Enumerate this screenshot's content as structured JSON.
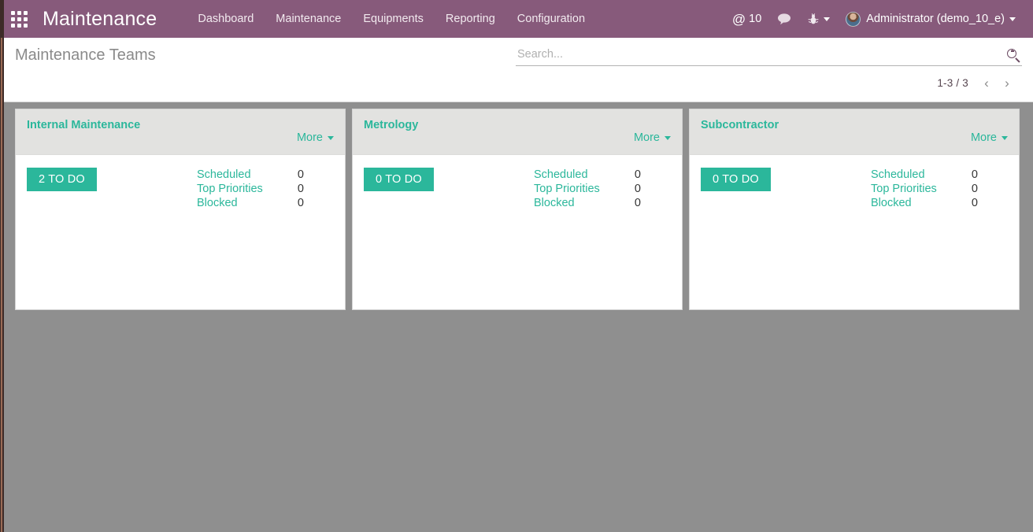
{
  "navbar": {
    "apps_icon": "apps-grid-icon",
    "brand": "Maintenance",
    "menu": [
      {
        "label": "Dashboard"
      },
      {
        "label": "Maintenance"
      },
      {
        "label": "Equipments"
      },
      {
        "label": "Reporting"
      },
      {
        "label": "Configuration"
      }
    ],
    "systray": {
      "mentions_glyph": "@",
      "mentions_count": "10",
      "messages_icon": "chat-bubble-icon",
      "debug_icon": "bug-icon",
      "user_name": "Administrator (demo_10_e)",
      "avatar_icon": "user-avatar"
    },
    "background_color": "#875a7b"
  },
  "control_panel": {
    "title": "Maintenance Teams",
    "search": {
      "value": "",
      "placeholder": "Search...",
      "icon": "magnifier-icon"
    },
    "pager": {
      "count": "1-3 / 3",
      "previous_glyph": "‹",
      "next_glyph": "›"
    }
  },
  "board": {
    "more_label": "More",
    "cards": [
      {
        "title": "Internal Maintenance",
        "todo_label": "2 TO DO",
        "stats": [
          {
            "label": "Scheduled",
            "value": "0"
          },
          {
            "label": "Top Priorities",
            "value": "0"
          },
          {
            "label": "Blocked",
            "value": "0"
          }
        ]
      },
      {
        "title": "Metrology",
        "todo_label": "0 TO DO",
        "stats": [
          {
            "label": "Scheduled",
            "value": "0"
          },
          {
            "label": "Top Priorities",
            "value": "0"
          },
          {
            "label": "Blocked",
            "value": "0"
          }
        ]
      },
      {
        "title": "Subcontractor",
        "todo_label": "0 TO DO",
        "stats": [
          {
            "label": "Scheduled",
            "value": "0"
          },
          {
            "label": "Top Priorities",
            "value": "0"
          },
          {
            "label": "Blocked",
            "value": "0"
          }
        ]
      }
    ]
  },
  "theme": {
    "brand_purple": "#875a7b",
    "accent_teal": "#2bb79b",
    "board_background": "#8f8f8f",
    "card_header": "#e2e2e0"
  }
}
